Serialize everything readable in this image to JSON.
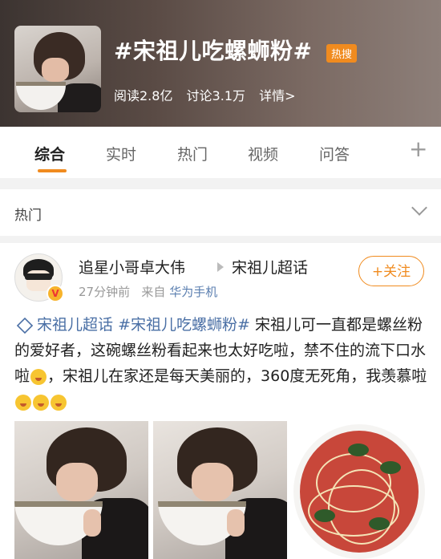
{
  "header": {
    "title": "#宋祖儿吃螺蛳粉#",
    "badge": "热搜",
    "reads": "阅读2.8亿",
    "discussions": "讨论3.1万",
    "details": "详情>"
  },
  "tabs": [
    "综合",
    "实时",
    "热门",
    "视频",
    "问答"
  ],
  "tabs_more": "+",
  "section": {
    "label": "热门"
  },
  "post": {
    "author": "追星小哥卓大伟",
    "super_topic": "宋祖儿超话",
    "time": "27分钟前",
    "from_label": "来自",
    "source": "华为手机",
    "follow": "+关注",
    "verified_icon": "V",
    "tags": [
      "宋祖儿超话",
      "#宋祖儿吃螺蛳粉#"
    ],
    "text1": "宋祖儿可一直都是螺丝粉的爱好者，这碗螺丝粉看起来也太好吃啦，禁不住的流下口水啦",
    "text2": "，宋祖儿在家还是每天美丽的，360度无死角，我羡慕啦"
  },
  "colors": {
    "accent": "#f08b1f",
    "link": "#4a6fa5"
  }
}
